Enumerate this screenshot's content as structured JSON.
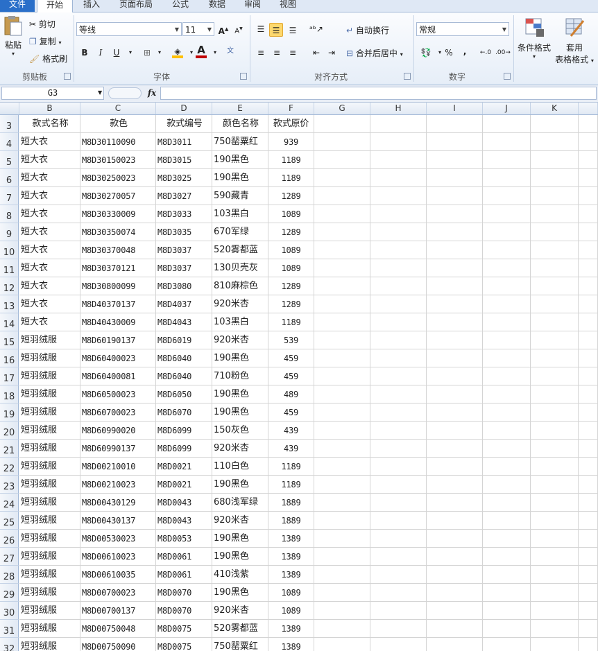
{
  "tabs": [
    "文件",
    "开始",
    "插入",
    "页面布局",
    "公式",
    "数据",
    "审阅",
    "视图"
  ],
  "clipboard": {
    "paste": "粘贴",
    "cut": "剪切",
    "copy": "复制",
    "format_painter": "格式刷",
    "group_label": "剪贴板"
  },
  "font": {
    "name": "等线",
    "size": "11",
    "bold": "B",
    "italic": "I",
    "underline": "U",
    "group_label": "字体",
    "font_color": "#c00000",
    "fill_color": "#ffc000"
  },
  "alignment": {
    "wrap_text": "自动换行",
    "merge_center": "合并后居中",
    "group_label": "对齐方式"
  },
  "number": {
    "format": "常规",
    "percent": "%",
    "comma": ",",
    "group_label": "数字"
  },
  "styles": {
    "conditional_format": "条件格式",
    "table_format_1": "套用",
    "table_format_2": "表格格式"
  },
  "name_box": "G3",
  "fx": "fx",
  "columns": [
    "B",
    "C",
    "D",
    "E",
    "F",
    "G",
    "H",
    "I",
    "J",
    "K"
  ],
  "rows": [
    {
      "n": "3",
      "b": "款式名称",
      "c": "款色",
      "d": "款式编号",
      "e": "颜色名称",
      "f": "款式原价"
    },
    {
      "n": "4",
      "b": "短大衣",
      "c": "M8D30110090",
      "d": "M8D3011",
      "e": "750罂粟红",
      "f": "939"
    },
    {
      "n": "5",
      "b": "短大衣",
      "c": "M8D30150023",
      "d": "M8D3015",
      "e": "190黑色",
      "f": "1189"
    },
    {
      "n": "6",
      "b": "短大衣",
      "c": "M8D30250023",
      "d": "M8D3025",
      "e": "190黑色",
      "f": "1189"
    },
    {
      "n": "7",
      "b": "短大衣",
      "c": "M8D30270057",
      "d": "M8D3027",
      "e": "590藏青",
      "f": "1289"
    },
    {
      "n": "8",
      "b": "短大衣",
      "c": "M8D30330009",
      "d": "M8D3033",
      "e": "103黑白",
      "f": "1089"
    },
    {
      "n": "9",
      "b": "短大衣",
      "c": "M8D30350074",
      "d": "M8D3035",
      "e": "670军绿",
      "f": "1289"
    },
    {
      "n": "10",
      "b": "短大衣",
      "c": "M8D30370048",
      "d": "M8D3037",
      "e": "520雾都蓝",
      "f": "1089"
    },
    {
      "n": "11",
      "b": "短大衣",
      "c": "M8D30370121",
      "d": "M8D3037",
      "e": "130贝壳灰",
      "f": "1089"
    },
    {
      "n": "12",
      "b": "短大衣",
      "c": "M8D30800099",
      "d": "M8D3080",
      "e": "810麻棕色",
      "f": "1289"
    },
    {
      "n": "13",
      "b": "短大衣",
      "c": "M8D40370137",
      "d": "M8D4037",
      "e": "920米杏",
      "f": "1289"
    },
    {
      "n": "14",
      "b": "短大衣",
      "c": "M8D40430009",
      "d": "M8D4043",
      "e": "103黑白",
      "f": "1189"
    },
    {
      "n": "15",
      "b": "短羽绒服",
      "c": "M8D60190137",
      "d": "M8D6019",
      "e": "920米杏",
      "f": "539"
    },
    {
      "n": "16",
      "b": "短羽绒服",
      "c": "M8D60400023",
      "d": "M8D6040",
      "e": "190黑色",
      "f": "459"
    },
    {
      "n": "17",
      "b": "短羽绒服",
      "c": "M8D60400081",
      "d": "M8D6040",
      "e": "710粉色",
      "f": "459"
    },
    {
      "n": "18",
      "b": "短羽绒服",
      "c": "M8D60500023",
      "d": "M8D6050",
      "e": "190黑色",
      "f": "489"
    },
    {
      "n": "19",
      "b": "短羽绒服",
      "c": "M8D60700023",
      "d": "M8D6070",
      "e": "190黑色",
      "f": "459"
    },
    {
      "n": "20",
      "b": "短羽绒服",
      "c": "M8D60990020",
      "d": "M8D6099",
      "e": "150灰色",
      "f": "439"
    },
    {
      "n": "21",
      "b": "短羽绒服",
      "c": "M8D60990137",
      "d": "M8D6099",
      "e": "920米杏",
      "f": "439"
    },
    {
      "n": "22",
      "b": "短羽绒服",
      "c": "M8D00210010",
      "d": "M8D0021",
      "e": "110白色",
      "f": "1189"
    },
    {
      "n": "23",
      "b": "短羽绒服",
      "c": "M8D00210023",
      "d": "M8D0021",
      "e": "190黑色",
      "f": "1189"
    },
    {
      "n": "24",
      "b": "短羽绒服",
      "c": "M8D00430129",
      "d": "M8D0043",
      "e": "680浅军绿",
      "f": "1889"
    },
    {
      "n": "25",
      "b": "短羽绒服",
      "c": "M8D00430137",
      "d": "M8D0043",
      "e": "920米杏",
      "f": "1889"
    },
    {
      "n": "26",
      "b": "短羽绒服",
      "c": "M8D00530023",
      "d": "M8D0053",
      "e": "190黑色",
      "f": "1389"
    },
    {
      "n": "27",
      "b": "短羽绒服",
      "c": "M8D00610023",
      "d": "M8D0061",
      "e": "190黑色",
      "f": "1389"
    },
    {
      "n": "28",
      "b": "短羽绒服",
      "c": "M8D00610035",
      "d": "M8D0061",
      "e": "410浅紫",
      "f": "1389"
    },
    {
      "n": "29",
      "b": "短羽绒服",
      "c": "M8D00700023",
      "d": "M8D0070",
      "e": "190黑色",
      "f": "1089"
    },
    {
      "n": "30",
      "b": "短羽绒服",
      "c": "M8D00700137",
      "d": "M8D0070",
      "e": "920米杏",
      "f": "1089"
    },
    {
      "n": "31",
      "b": "短羽绒服",
      "c": "M8D00750048",
      "d": "M8D0075",
      "e": "520雾都蓝",
      "f": "1389"
    },
    {
      "n": "32",
      "b": "短羽绒服",
      "c": "M8D00750090",
      "d": "M8D0075",
      "e": "750罂粟红",
      "f": "1389"
    }
  ]
}
